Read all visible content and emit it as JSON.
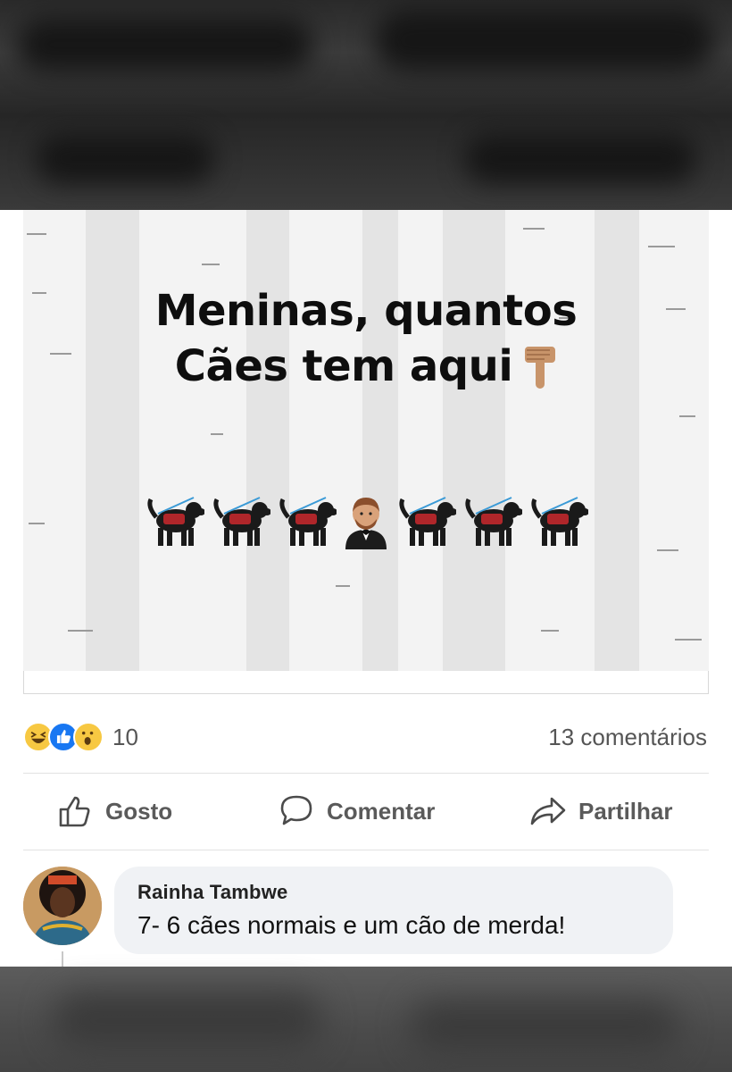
{
  "post": {
    "caption_line1": "Meninas, quantos",
    "caption_line2": "Cães tem aqui",
    "emoji_sequence": [
      "service-dog-icon",
      "service-dog-icon",
      "service-dog-icon",
      "man-in-tuxedo-icon",
      "service-dog-icon",
      "service-dog-icon",
      "service-dog-icon"
    ],
    "reactions": {
      "icons": [
        "haha-icon",
        "like-icon",
        "wow-icon"
      ],
      "count": "10"
    },
    "comments_count": "13 comentários",
    "actions": {
      "like": "Gosto",
      "comment": "Comentar",
      "share": "Partilhar"
    }
  },
  "comment": {
    "author": "Rainha Tambwe",
    "text": "7- 6 cães normais e um cão de merda!"
  },
  "colors": {
    "like_blue": "#1877f2",
    "reaction_yellow": "#f7c842",
    "bubble_bg": "#f0f2f5"
  }
}
